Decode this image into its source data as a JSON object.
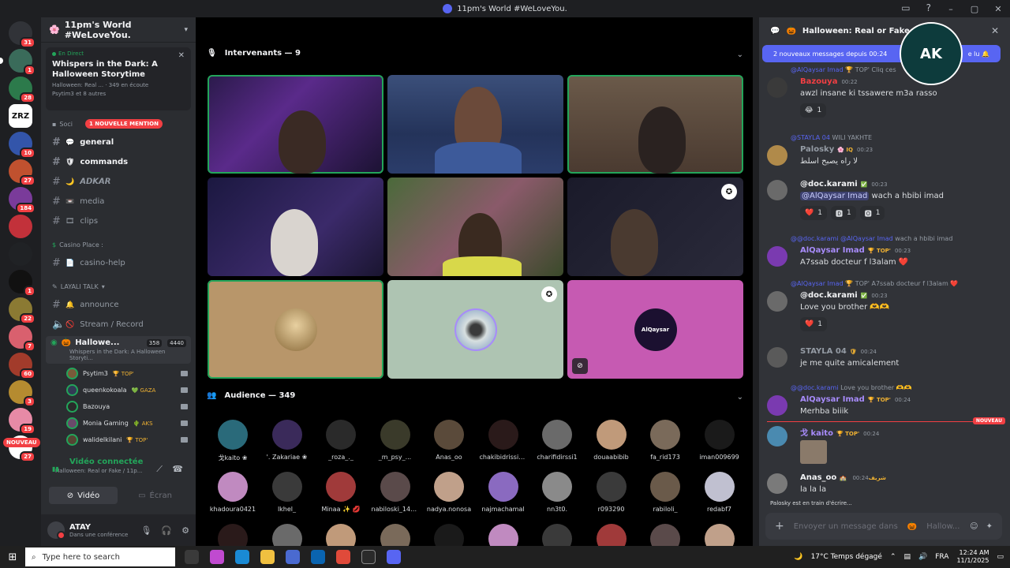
{
  "window": {
    "title": "11pm's World #WeLoveYou."
  },
  "guilds": [
    {
      "name": "discord-home",
      "badge": "31",
      "color": "#313338"
    },
    {
      "name": "server-1",
      "badge": "1",
      "color": "#3a6b5a"
    },
    {
      "name": "server-2",
      "badge": "28",
      "color": "#2c7a4b"
    },
    {
      "name": "server-zrz",
      "label": "ZRZ",
      "badge": "",
      "color": "#ffffff"
    },
    {
      "name": "server-4",
      "badge": "10",
      "color": "#3355aa"
    },
    {
      "name": "server-5",
      "badge": "27",
      "color": "#c0512f"
    },
    {
      "name": "server-6",
      "badge": "184",
      "color": "#7a3b9a"
    },
    {
      "name": "server-7",
      "badge": "",
      "color": "#c2313a"
    },
    {
      "name": "server-8",
      "badge": "",
      "color": "#202225"
    },
    {
      "name": "server-9",
      "badge": "1",
      "color": "#111111"
    },
    {
      "name": "server-10",
      "badge": "22",
      "color": "#8b7a33"
    },
    {
      "name": "server-11",
      "badge": "7",
      "color": "#d9606e"
    },
    {
      "name": "server-12",
      "badge": "60",
      "color": "#a23b2b"
    },
    {
      "name": "server-13",
      "badge": "3",
      "color": "#b58b30"
    },
    {
      "name": "server-14",
      "badge": "19",
      "color": "#e78aa6"
    },
    {
      "name": "server-15",
      "badge": "27",
      "color": "#ffffff"
    }
  ],
  "guild_nouveau": "NOUVEAU",
  "server": {
    "name": "11pm's World #WeLoveYou."
  },
  "event": {
    "live_label": "En Direct",
    "title": "Whispers in the Dark: A Halloween Storytime",
    "meta": "Halloween: Real ... · 349 en écoute",
    "people": "Psytim3 et 8 autres"
  },
  "mention_pill": "1 NOUVELLE MENTION",
  "categories": {
    "social": "Soci",
    "casino": "Casino Place :",
    "layali": "LAYALI TALK"
  },
  "channels": [
    {
      "id": "general",
      "label": "general",
      "icon": "💬"
    },
    {
      "id": "commands",
      "label": "commands",
      "icon": "🛡"
    },
    {
      "id": "adkar",
      "label": "𝘼𝘿𝙆𝘼𝙍",
      "icon": "🌙"
    },
    {
      "id": "media",
      "label": "media",
      "icon": "📼"
    },
    {
      "id": "clips",
      "label": "clips",
      "icon": "🎞"
    },
    {
      "id": "casino-help",
      "label": "casino-help",
      "icon": "📄"
    },
    {
      "id": "announce",
      "label": "announce",
      "icon": "🔔"
    },
    {
      "id": "stream-record",
      "label": "Stream / Record",
      "icon": "🚫"
    }
  ],
  "voice_channel": {
    "name": "Hallowe...",
    "count_a": "358",
    "count_b": "4440",
    "subtitle": "Whispers in the Dark: A Halloween Storyti..."
  },
  "voice_users": [
    {
      "name": "Psytim3",
      "tag": "🏆 TOP'",
      "color": "#7a5a3a"
    },
    {
      "name": "queenkokoala",
      "tag": "💚 GAZA",
      "color": "#333a55"
    },
    {
      "name": "Bazouya",
      "tag": "",
      "color": "#2a2a2a"
    },
    {
      "name": "Monia Gaming",
      "tag": "🌵 AKS",
      "color": "#6a4a6a"
    },
    {
      "name": "walidelkilani",
      "tag": "🏆 TOP'",
      "color": "#554433"
    }
  ],
  "voice_panel": {
    "title": "Vidéo connectée",
    "subtitle": "Halloween: Real or Fake / 11p...",
    "tab_video": "Vidéo",
    "tab_screen": "Écran"
  },
  "user": {
    "name": "ATAY",
    "status": "Dans une conférence"
  },
  "stage": {
    "speakers_label": "Intervenants — 9",
    "audience_label": "Audience — 349",
    "alqaysar": "AlQaysar"
  },
  "audience": [
    "戈kaito ❀",
    "'. Zakariae ❀",
    "_roza_._",
    "_m_psy_...",
    "Anas_oo",
    "chakibidrissi7...",
    "charifidirssi1",
    "douaabibib",
    "fa_rid173",
    "iman009699",
    "khadoura0421",
    "lkhel_",
    "Minaa ✨ 💋",
    "nabiloski_14921",
    "nadya.nonosa",
    "najmachamal",
    "nn3t0.",
    "r093290",
    "rabiloli_",
    "redabf7"
  ],
  "chat": {
    "title": "Halloween: Real or Fake",
    "new_messages": "2 nouveaux messages depuis 00:24",
    "mark_read": "e lu",
    "nouveau": "NOUVEAU",
    "typing": "Palosky est en train d'écrire...",
    "placeholder": "Envoyer un message dans",
    "placeholder_chan": "Hallow...",
    "messages": [
      {
        "reply": "@AlQaysar Imad",
        "reply_tag": "🏆 TOP'",
        "reply_text": "Cliq",
        "reply_tail": "ces",
        "author": "Bazouya",
        "author_color": "#f23f43",
        "time": "00:22",
        "text": "awzl insane ki tssawere m3a rasso",
        "reacts": [
          {
            "e": "😂",
            "n": "1"
          }
        ]
      },
      {
        "reply": "@STAYLA 04",
        "reply_text": "WILI YAKHTE",
        "author": "Palosky",
        "author_color": "#949ba4",
        "tag": "🌸 IQ",
        "time": "00:23",
        "text": "لا راه يصبح اسلط",
        "reacts": []
      },
      {
        "author": "@doc.karami",
        "author_color": "#f2f3f5",
        "tag": "✅",
        "time": "00:23",
        "text_mention": "@AlQaysar Imad",
        "text": "wach a hbibi imad",
        "reacts": [
          {
            "e": "❤️",
            "n": "1"
          },
          {
            "e": "🅳",
            "n": "1"
          },
          {
            "e": "🅾",
            "n": "1"
          }
        ]
      },
      {
        "reply": "@@doc.karami",
        "reply_mention": "@AlQaysar Imad",
        "reply_text": "wach a hbibi imad",
        "author": "AlQaysar Imad",
        "author_color": "#a78bfa",
        "tag": "🏆 TOP'",
        "time": "00:23",
        "text": "A7ssab docteur f l3alam ❤️",
        "reacts": []
      },
      {
        "reply": "@AlQaysar Imad",
        "reply_tag": "🏆 TOP'",
        "reply_text": "A7ssab docteur f l3alam ❤️",
        "author": "@doc.karami",
        "author_color": "#f2f3f5",
        "tag": "✅",
        "time": "00:23",
        "text": "Love you brother 🫶🫶",
        "reacts": [
          {
            "e": "❤️",
            "n": "1"
          }
        ]
      },
      {
        "author": "STAYLA 04",
        "author_color": "#949ba4",
        "tag": "🛡",
        "time": "00:24",
        "text": "je me quite amicalement",
        "reacts": []
      },
      {
        "reply": "@@doc.karami",
        "reply_text": "Love you brother 🫶🫶",
        "author": "AlQaysar Imad",
        "author_color": "#a78bfa",
        "tag": "🏆 TOP'",
        "time": "00:24",
        "text": "Merhba biiik",
        "reacts": []
      },
      {
        "author": "戈 kaito",
        "author_color": "#a78bfa",
        "tag": "🏆 TOP'",
        "time": "00:24",
        "text": "",
        "reacts": []
      },
      {
        "author": "Anas_oo",
        "author_color": "#f2f3f5",
        "tag": "🏫 شريف",
        "time": "00:24",
        "text": "la la la",
        "reacts": []
      }
    ]
  },
  "taskbar": {
    "search": "Type here to search",
    "weather": "17°C  Temps dégagé",
    "lang": "FRA",
    "time": "12:24 AM",
    "date": "11/1/2025"
  }
}
